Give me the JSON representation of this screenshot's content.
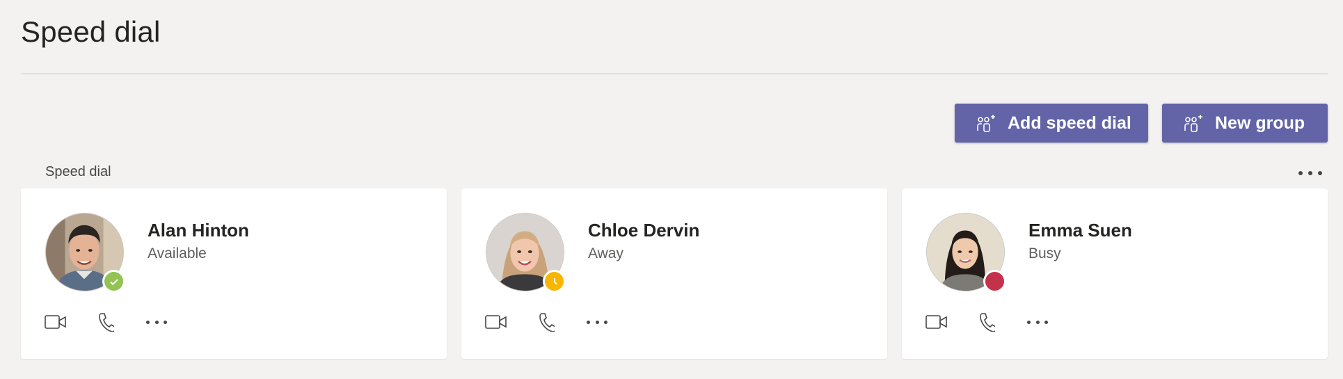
{
  "page": {
    "title": "Speed dial"
  },
  "toolbar": {
    "add_speed_dial_label": "Add speed dial",
    "new_group_label": "New group",
    "button_color": "#6264a7",
    "icon": "people-add-icon"
  },
  "section": {
    "label": "Speed dial",
    "more_icon": "more-horizontal-icon"
  },
  "contacts": [
    {
      "name": "Alan Hinton",
      "status": "Available",
      "presence": "available",
      "presence_color": "#92c353",
      "presence_icon": "checkmark-icon"
    },
    {
      "name": "Chloe Dervin",
      "status": "Away",
      "presence": "away",
      "presence_color": "#f8b600",
      "presence_icon": "clock-icon"
    },
    {
      "name": "Emma Suen",
      "status": "Busy",
      "presence": "busy",
      "presence_color": "#c4314b",
      "presence_icon": "busy-dot"
    }
  ],
  "card_actions": [
    "video-call-icon",
    "audio-call-icon",
    "more-options-icon"
  ]
}
